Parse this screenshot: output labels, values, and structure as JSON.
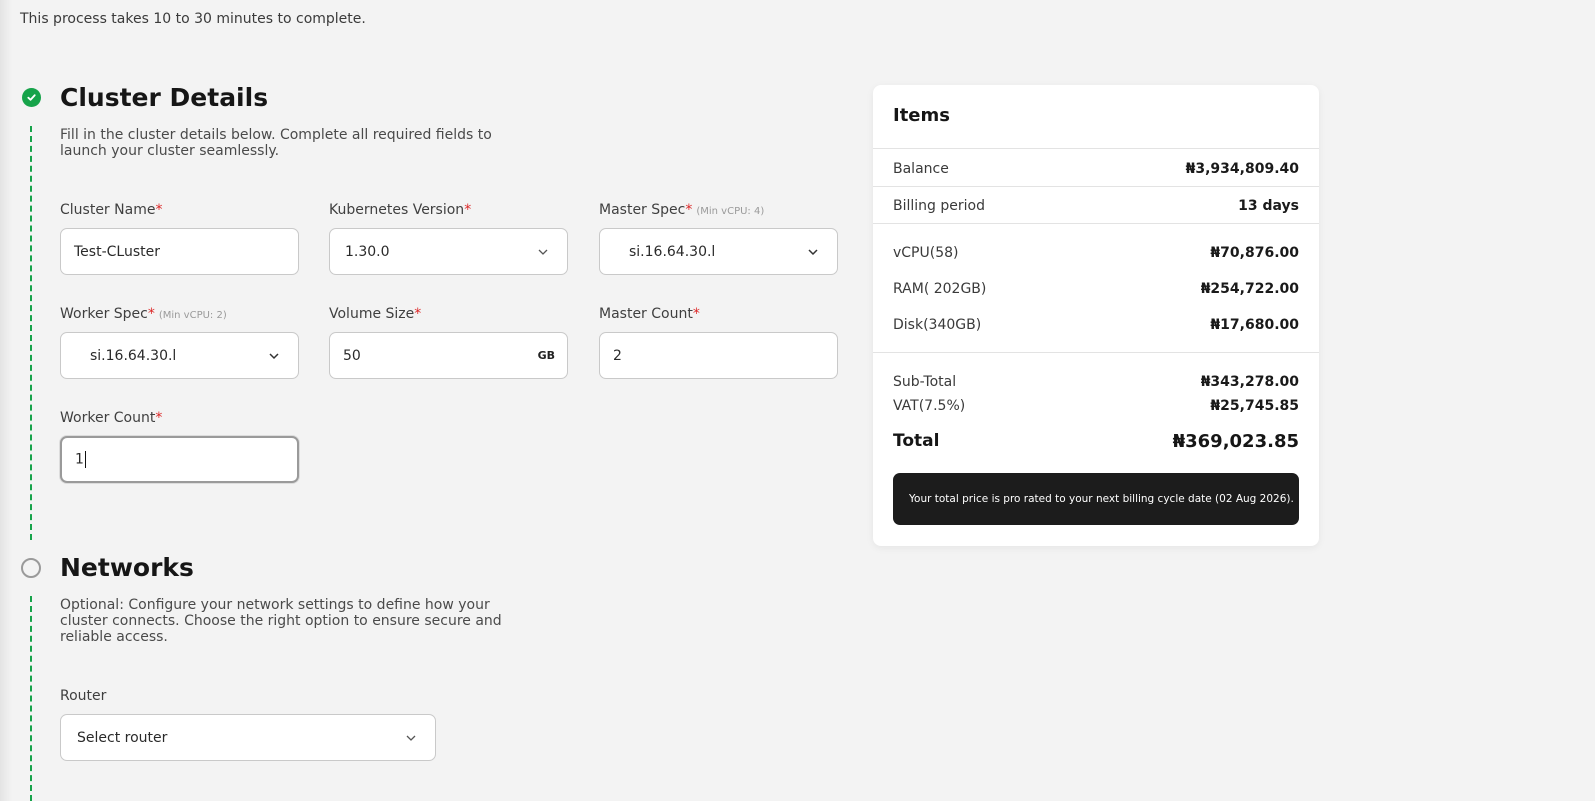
{
  "intro_text": "This process takes 10 to 30 minutes to complete.",
  "colors": {
    "accent": "#16a34a",
    "required": "#dc2626",
    "notice_bg": "#1c1c1c"
  },
  "cluster_details": {
    "title": "Cluster Details",
    "description": "Fill in the cluster details below. Complete all required fields to launch your cluster seamlessly.",
    "status_icon": "check-icon",
    "fields": {
      "cluster_name": {
        "label": "Cluster Name",
        "required": "*",
        "value": "Test-CLuster"
      },
      "kubernetes_version": {
        "label": "Kubernetes Version",
        "required": "*",
        "value": "1.30.0"
      },
      "master_spec": {
        "label": "Master Spec",
        "required": "*",
        "hint": "(Min vCPU: 4)",
        "value": "si.16.64.30.l"
      },
      "worker_spec": {
        "label": "Worker Spec",
        "required": "*",
        "hint": "(Min vCPU: 2)",
        "value": "si.16.64.30.l"
      },
      "volume_size": {
        "label": "Volume Size",
        "required": "*",
        "value": "50",
        "unit": "GB"
      },
      "master_count": {
        "label": "Master Count",
        "required": "*",
        "value": "2"
      },
      "worker_count": {
        "label": "Worker Count",
        "required": "*",
        "value": "1"
      }
    }
  },
  "networks": {
    "title": "Networks",
    "description": "Optional: Configure your network settings to define how your cluster connects. Choose the right option to ensure secure and reliable access.",
    "router": {
      "label": "Router",
      "placeholder": "Select router"
    }
  },
  "summary": {
    "title": "Items",
    "balance": {
      "label": "Balance",
      "value": "₦3,934,809.40"
    },
    "billing_period": {
      "label": "Billing period",
      "value": "13 days"
    },
    "lines": [
      {
        "label": "vCPU(58)",
        "value": "₦70,876.00"
      },
      {
        "label": "RAM( 202GB)",
        "value": "₦254,722.00"
      },
      {
        "label": "Disk(340GB)",
        "value": "₦17,680.00"
      }
    ],
    "subtotal": {
      "label": "Sub-Total",
      "value": "₦343,278.00"
    },
    "vat": {
      "label": "VAT(7.5%)",
      "value": "₦25,745.85"
    },
    "total": {
      "label": "Total",
      "value": "₦369,023.85"
    },
    "notice": "Your total price is pro rated to your next billing cycle date (02 Aug 2026)."
  }
}
